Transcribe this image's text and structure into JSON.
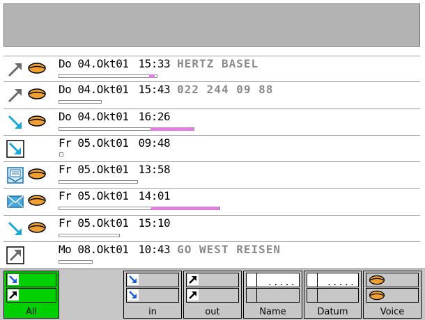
{
  "window": {
    "title": ""
  },
  "colors": {
    "accent": "#00d000",
    "caller": "#8a8a8a",
    "duration_fill": "#e07fe0",
    "titlebar": "#b3b3b3"
  },
  "calls": [
    {
      "direction_icon": "outgoing-arrow-icon",
      "voice_icon": "lips-icon",
      "date": "Do 04.Okt01",
      "time": "15:33",
      "caller": "HERTZ BASEL",
      "duration_fraction": 0.05
    },
    {
      "direction_icon": "outgoing-arrow-icon",
      "voice_icon": "lips-icon",
      "date": "Do 04.Okt01",
      "time": "15:43",
      "caller": "022 244 09 88",
      "duration_fraction": 0.0
    },
    {
      "direction_icon": "incoming-arrow-icon",
      "voice_icon": "lips-icon",
      "date": "Do 04.Okt01",
      "time": "16:26",
      "caller": "",
      "duration_fraction": 0.19
    },
    {
      "direction_icon": "incoming-box-arrow-icon",
      "voice_icon": "",
      "date": "Fr 05.Okt01",
      "time": "09:48",
      "caller": "",
      "duration_fraction": 0.0
    },
    {
      "direction_icon": "fax-mail-icon",
      "voice_icon": "lips-icon",
      "date": "Fr 05.Okt01",
      "time": "13:58",
      "caller": "",
      "duration_fraction": 0.0
    },
    {
      "direction_icon": "envelope-icon",
      "voice_icon": "lips-icon",
      "date": "Fr 05.Okt01",
      "time": "14:01",
      "caller": "",
      "duration_fraction": 0.43
    },
    {
      "direction_icon": "incoming-arrow-icon",
      "voice_icon": "lips-icon",
      "date": "Fr 05.Okt01",
      "time": "15:10",
      "caller": "",
      "duration_fraction": 0.0
    },
    {
      "direction_icon": "outgoing-box-arrow-icon",
      "voice_icon": "",
      "date": "Mo 08.Okt01",
      "time": "10:43",
      "caller": "GO WEST REISEN",
      "duration_fraction": 0.0
    }
  ],
  "filters": {
    "all": {
      "label": "All",
      "active": true
    },
    "in": {
      "label": "in"
    },
    "out": {
      "label": "out"
    },
    "name": {
      "label": "Name",
      "dots": "....."
    },
    "datum": {
      "label": "Datum",
      "dots": "....."
    },
    "voice": {
      "label": "Voice"
    }
  }
}
